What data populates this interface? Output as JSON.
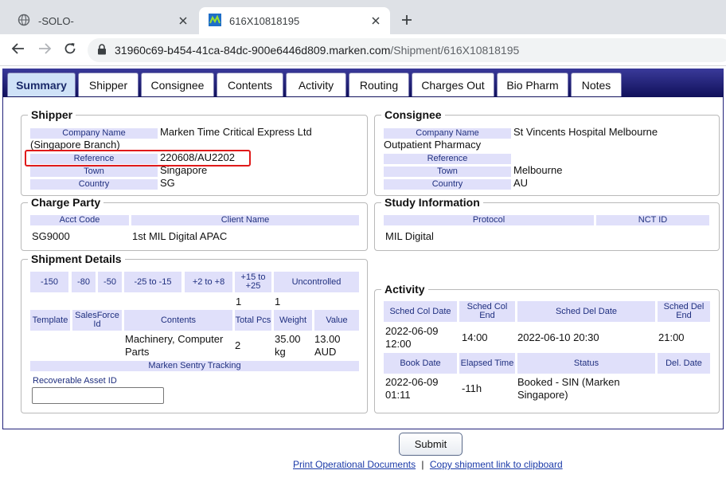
{
  "browser": {
    "tabs": [
      {
        "title": "-SOLO-"
      },
      {
        "title": "616X10818195"
      }
    ],
    "url_host": "31960c69-b454-41ca-84dc-900e6446d809.marken.com",
    "url_path": "/Shipment/616X10818195"
  },
  "app_tabs": [
    "Summary",
    "Shipper",
    "Consignee",
    "Contents",
    "Activity",
    "Routing",
    "Charges Out",
    "Bio Pharm",
    "Notes"
  ],
  "shipper": {
    "legend": "Shipper",
    "company_label": "Company Name",
    "company": "Marken Time Critical Express Ltd (Singapore Branch)",
    "reference_label": "Reference",
    "reference": "220608/AU2202",
    "town_label": "Town",
    "town": "Singapore",
    "country_label": "Country",
    "country": "SG"
  },
  "consignee": {
    "legend": "Consignee",
    "company_label": "Company Name",
    "company": "St Vincents Hospital Melbourne Outpatient Pharmacy",
    "reference_label": "Reference",
    "reference": "",
    "town_label": "Town",
    "town": "Melbourne",
    "country_label": "Country",
    "country": "AU"
  },
  "charge_party": {
    "legend": "Charge Party",
    "acct_code_label": "Acct Code",
    "client_name_label": "Client Name",
    "acct_code": "SG9000",
    "client_name": "1st MIL Digital APAC"
  },
  "study": {
    "legend": "Study Information",
    "protocol_label": "Protocol",
    "nct_label": "NCT ID",
    "protocol": "MIL Digital",
    "nct": ""
  },
  "shipment_details": {
    "legend": "Shipment Details",
    "temp_headers": [
      "-150",
      "-80",
      "-50",
      "-25 to -15",
      "+2 to +8",
      "+15 to +25",
      "Uncontrolled"
    ],
    "temp_values": [
      "",
      "",
      "",
      "",
      "",
      "1",
      "1"
    ],
    "headers": [
      "Template",
      "SalesForce Id",
      "Contents",
      "Total Pcs",
      "Weight",
      "Value"
    ],
    "row": {
      "template": "",
      "salesforce_id": "",
      "contents": "Machinery, Computer Parts",
      "total_pcs": "2",
      "weight": "35.00 kg",
      "value": "13.00 AUD"
    },
    "sentry_label": "Marken Sentry Tracking",
    "recoverable_label": "Recoverable Asset ID",
    "recoverable_value": ""
  },
  "activity": {
    "legend": "Activity",
    "headers1": [
      "Sched Col Date",
      "Sched Col End",
      "Sched Del Date",
      "Sched Del End"
    ],
    "row1": [
      "2022-06-09 12:00",
      "14:00",
      "2022-06-10 20:30",
      "21:00"
    ],
    "headers2": [
      "Book Date",
      "Elapsed Time",
      "Status",
      "Del. Date"
    ],
    "row2": [
      "2022-06-09 01:11",
      "-11h",
      "Booked - SIN (Marken Singapore)",
      ""
    ]
  },
  "footer": {
    "submit_label": "Submit",
    "print_link": "Print Operational Documents",
    "separator": "|",
    "copy_link": "Copy shipment link to clipboard"
  }
}
